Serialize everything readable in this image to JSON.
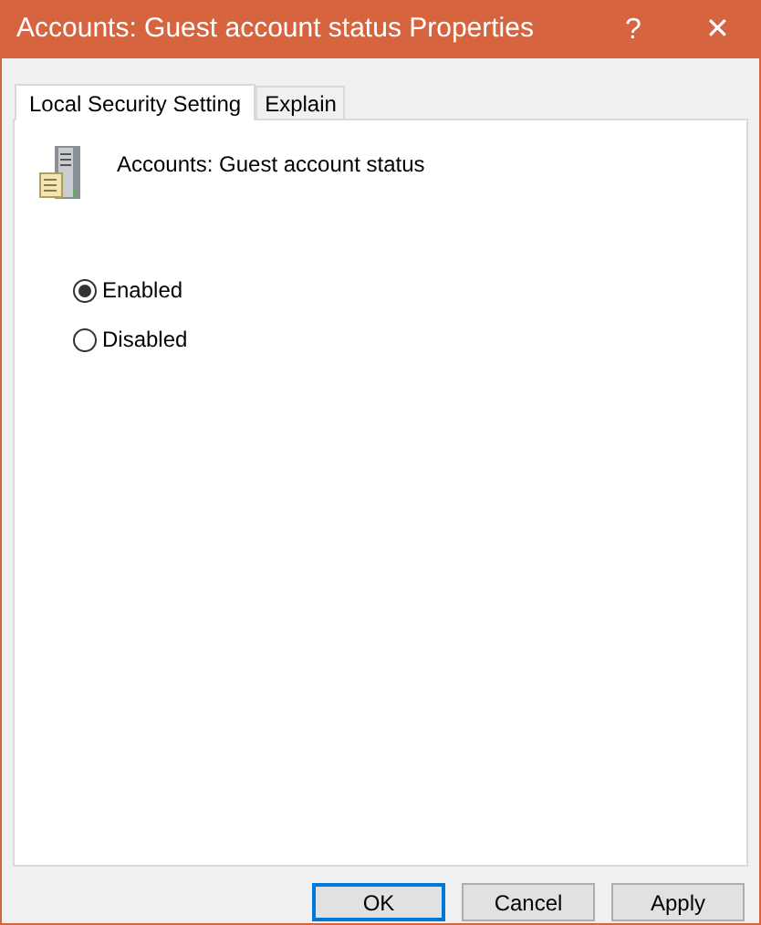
{
  "window": {
    "title": "Accounts: Guest account status Properties",
    "help": "?",
    "close": "✕"
  },
  "tabs": [
    {
      "label": "Local Security Setting",
      "selected": true
    },
    {
      "label": "Explain",
      "selected": false
    }
  ],
  "policy_name": "Accounts: Guest account status",
  "options": [
    {
      "label": "Enabled",
      "selected": true
    },
    {
      "label": "Disabled",
      "selected": false
    }
  ],
  "buttons": [
    {
      "label": "OK",
      "default": true
    },
    {
      "label": "Cancel",
      "default": false
    },
    {
      "label": "Apply",
      "default": false
    }
  ]
}
